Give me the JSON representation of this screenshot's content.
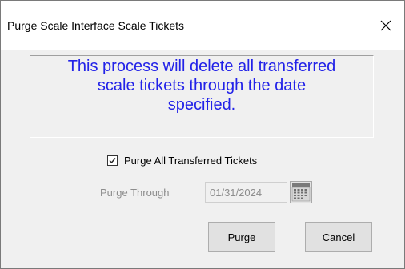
{
  "window": {
    "title": "Purge Scale Interface Scale Tickets"
  },
  "message": {
    "line1": "This process will delete all transferred",
    "line2": "scale tickets through the date",
    "line3": "specified."
  },
  "options": {
    "purge_all_label": "Purge All Transferred Tickets",
    "purge_all_checked": true,
    "purge_through_label": "Purge Through",
    "purge_through_value": "01/31/2024"
  },
  "buttons": {
    "purge_label": "Purge",
    "cancel_label": "Cancel"
  },
  "icons": {
    "close": "close-icon",
    "calendar": "calendar-icon",
    "checkmark": "checkmark-icon"
  },
  "colors": {
    "message_text": "#2222e8",
    "disabled_text": "#8d8d8d",
    "dialog_background": "#f0f0f0"
  }
}
